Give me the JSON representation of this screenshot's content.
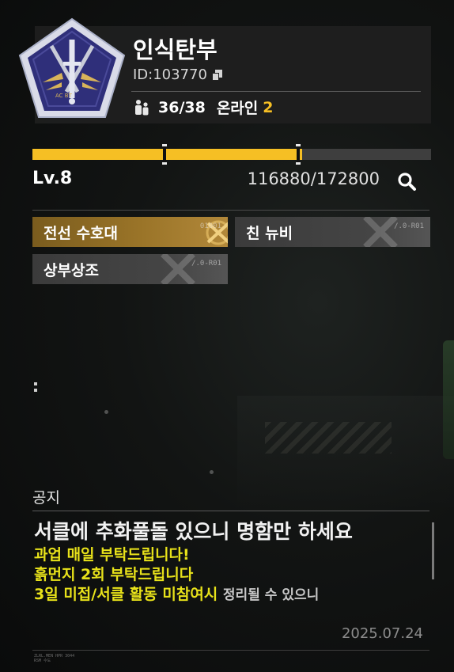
{
  "circle": {
    "name": "인식탄부",
    "id_label": "ID:",
    "id_value": "103770",
    "members": "36/38",
    "online_label": "온라인",
    "online_count": "2",
    "emblem_text": "AC BT"
  },
  "level": {
    "label": "Lv.8",
    "xp_text": "116880/172800",
    "xp_fraction": 0.676
  },
  "tags": [
    {
      "label": "전선 수호대",
      "code": "01001",
      "style": "gold"
    },
    {
      "label": "친 뉴비",
      "code": "/.0-R01",
      "style": "gray"
    },
    {
      "label": "상부상조",
      "code": "/.0-R01",
      "style": "gray"
    }
  ],
  "notice": {
    "title": "공지",
    "line1": "서클에 추화풀돌 있으니 명함만 하세요",
    "line2": "과업 매일 부탁드립니다!",
    "line3": "흙먼지 2회 부탁드립니다",
    "line4_bold": "3일 미접/서클 활동 미참여시",
    "line4_small": "정리될 수 있으니",
    "date": "2025.07.24"
  },
  "footer": {
    "line1": "ZLRL.MEN HPR 3044",
    "line2": "RSM 수도"
  },
  "colors": {
    "accent": "#f6bf24",
    "notice_yellow": "#e8e21a",
    "emblem_blue": "#2f2f7a",
    "emblem_gold": "#d8b45a"
  },
  "icons": {
    "members": "members-icon",
    "copy": "copy-icon",
    "search": "search-icon",
    "tag_badge": "crossed-swords-icon"
  }
}
